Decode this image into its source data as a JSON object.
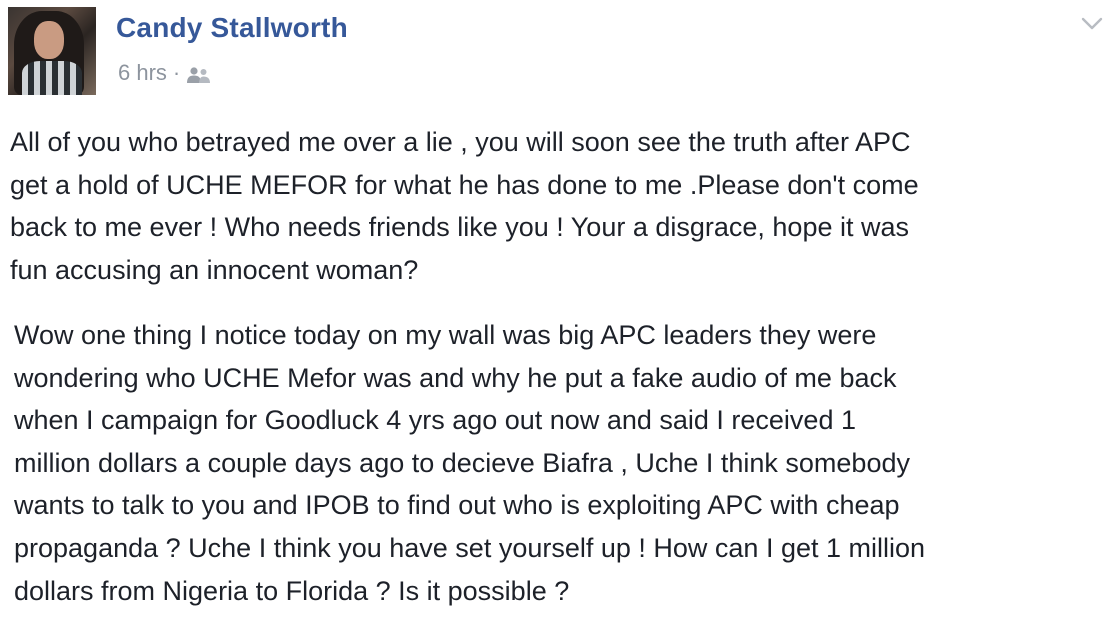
{
  "post": {
    "author": "Candy Stallworth",
    "time": "6 hrs",
    "separator": "·",
    "audience_icon": "friends-icon",
    "menu_icon": "chevron-down-icon",
    "paragraphs": [
      "All of you who betrayed me over a lie , you will soon see the truth after APC\nget a hold of UCHE MEFOR for what he has done to me .Please don't come\nback to me ever ! Who needs friends like you ! Your a disgrace, hope it was\nfun accusing an innocent woman?",
      "Wow one thing I notice today on my wall was big APC leaders they were\nwondering who UCHE Mefor was and why he put a fake audio of me back\nwhen I campaign for Goodluck 4 yrs ago out now and said I received 1\nmillion dollars a couple days ago to decieve Biafra , Uche I think somebody\nwants to talk to you and IPOB to find out who is exploiting APC with cheap\npropaganda ? Uche I think you have set yourself up ! How can I get 1 million\ndollars from Nigeria to Florida ? Is it possible ?"
    ]
  },
  "colors": {
    "author": "#365899",
    "meta": "#8d949e",
    "body_text": "#1d2129"
  }
}
